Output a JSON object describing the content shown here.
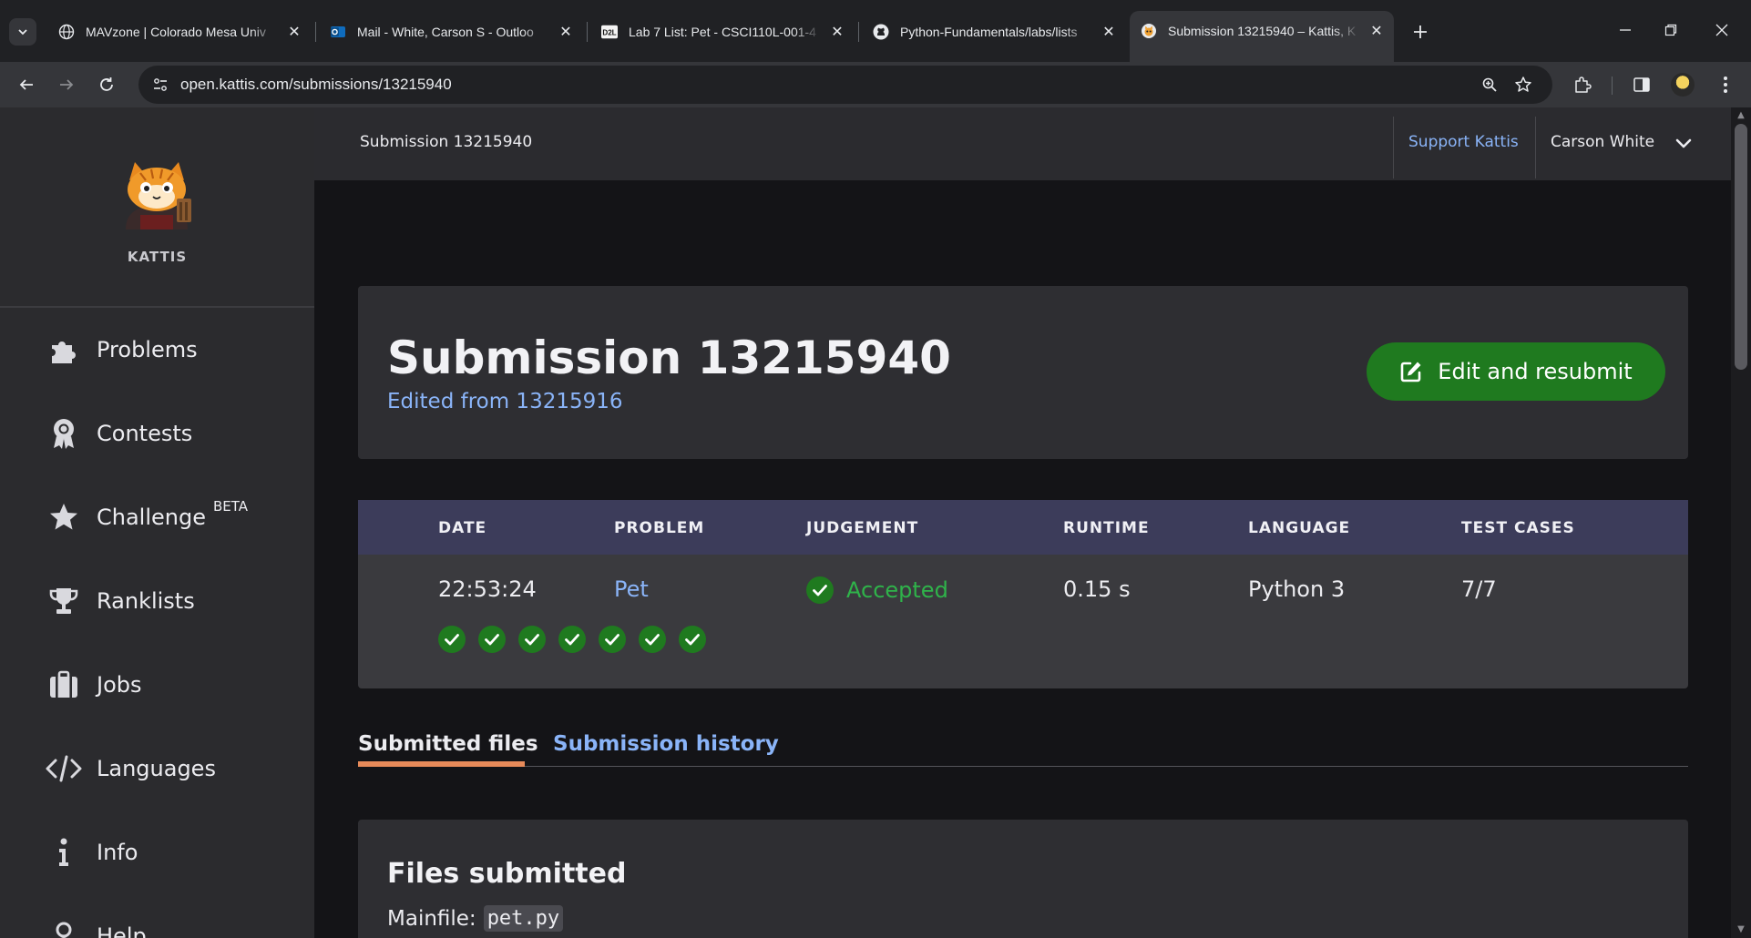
{
  "browser": {
    "tabs": [
      {
        "title": "MAVzone | Colorado Mesa Univ",
        "icon": "globe-icon"
      },
      {
        "title": "Mail - White, Carson S - Outloo",
        "icon": "outlook-icon"
      },
      {
        "title": "Lab 7 List: Pet - CSCI110L-001-4",
        "icon": "d2l-icon"
      },
      {
        "title": "Python-Fundamentals/labs/lists",
        "icon": "github-icon"
      },
      {
        "title": "Submission 13215940 – Kattis, K",
        "icon": "kattis-icon",
        "active": true
      }
    ],
    "d2l_label": "D2L",
    "url": "open.kattis.com/submissions/13215940"
  },
  "sidebar": {
    "brand": "KATTIS",
    "items": [
      {
        "label": "Problems",
        "icon": "puzzle-icon"
      },
      {
        "label": "Contests",
        "icon": "award-icon"
      },
      {
        "label": "Challenge",
        "badge": "BETA",
        "icon": "star-icon"
      },
      {
        "label": "Ranklists",
        "icon": "trophy-icon"
      },
      {
        "label": "Jobs",
        "icon": "briefcase-icon"
      },
      {
        "label": "Languages",
        "icon": "code-icon"
      },
      {
        "label": "Info",
        "icon": "info-icon"
      },
      {
        "label": "Help",
        "icon": "user-icon"
      }
    ]
  },
  "topbar": {
    "breadcrumb": "Submission 13215940",
    "support": "Support Kattis",
    "user": "Carson White"
  },
  "submission": {
    "title": "Submission 13215940",
    "edited_from": "Edited from 13215916",
    "resubmit_label": "Edit and resubmit",
    "columns": [
      "DATE",
      "PROBLEM",
      "JUDGEMENT",
      "RUNTIME",
      "LANGUAGE",
      "TEST CASES"
    ],
    "row": {
      "date": "22:53:24",
      "problem": "Pet",
      "judgement": "Accepted",
      "runtime": "0.15 s",
      "language": "Python 3",
      "test_cases": "7/7"
    },
    "test_results": [
      "pass",
      "pass",
      "pass",
      "pass",
      "pass",
      "pass",
      "pass"
    ]
  },
  "tabs": {
    "submitted_files": "Submitted files",
    "submission_history": "Submission history"
  },
  "files": {
    "heading": "Files submitted",
    "mainfile_label": "Mainfile:",
    "mainfile": "pet.py"
  },
  "colors": {
    "accent_green": "#1f7a1f",
    "accepted_green": "#2fb34a",
    "link_blue": "#8ab4f8",
    "tab_underline": "#e88b5a"
  }
}
